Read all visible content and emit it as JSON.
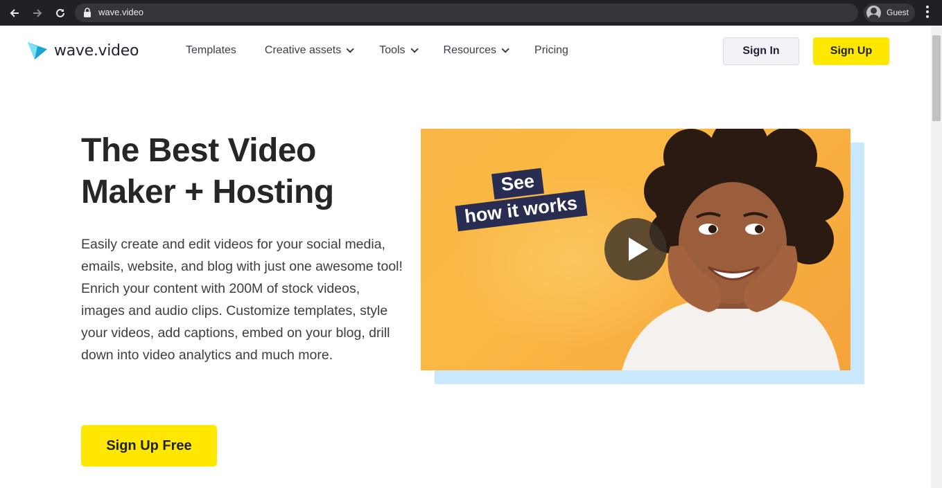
{
  "browser": {
    "url": "wave.video",
    "profile_name": "Guest"
  },
  "header": {
    "brand": "wave.video",
    "nav": [
      {
        "label": "Templates",
        "has_dropdown": false
      },
      {
        "label": "Creative assets",
        "has_dropdown": true
      },
      {
        "label": "Tools",
        "has_dropdown": true
      },
      {
        "label": "Resources",
        "has_dropdown": true
      },
      {
        "label": "Pricing",
        "has_dropdown": false
      }
    ],
    "sign_in_label": "Sign In",
    "sign_up_label": "Sign Up"
  },
  "hero": {
    "title_line1": "The Best Video",
    "title_line2": "Maker + Hosting",
    "paragraph1": "Easily create and edit videos for your social media, emails, website, and blog with just one awesome tool!",
    "paragraph2": "Enrich your content with 200M of stock videos, images and audio clips. Customize templates, style your videos, add captions, embed on your blog, drill down into video analytics and much more.",
    "cta_label": "Sign Up Free"
  },
  "video": {
    "tag_line1": "See",
    "tag_line2": "how it works"
  },
  "colors": {
    "accent_yellow": "#ffe700",
    "video_bg": "#f7b744",
    "tag_navy": "#2a2d52",
    "shadow_blue": "#c9e8fb"
  }
}
